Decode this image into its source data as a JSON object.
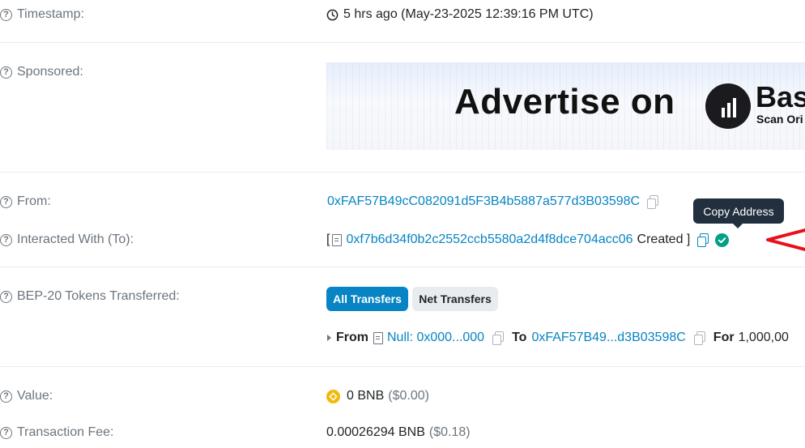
{
  "timestamp": {
    "label": "Timestamp:",
    "value": "5 hrs ago (May-23-2025 12:39:16 PM UTC)"
  },
  "sponsored": {
    "label": "Sponsored:",
    "ad_text": "Advertise on",
    "brand_text": "Bas",
    "brand_sub": "Scan Ori"
  },
  "from": {
    "label": "From:",
    "address": "0xFAF57B49cC082091d5F3B4b5887a577d3B03598C"
  },
  "interacted": {
    "label": "Interacted With (To):",
    "open_bracket": "[",
    "address": "0xf7b6d34f0b2c2552ccb5580a2d4f8dce704acc06",
    "created": "Created ]",
    "tooltip": "Copy Address"
  },
  "tokens": {
    "label": "BEP-20 Tokens Transferred:",
    "tab_all": "All Transfers",
    "tab_net": "Net Transfers",
    "from_kw": "From",
    "from_addr": "Null: 0x000...000",
    "to_kw": "To",
    "to_addr": "0xFAF57B49...d3B03598C",
    "for_kw": "For",
    "amount": "1,000,00"
  },
  "value": {
    "label": "Value:",
    "amount": "0 BNB",
    "usd": "($0.00)"
  },
  "fee": {
    "label": "Transaction Fee:",
    "amount": "0.00026294 BNB",
    "usd": "($0.18)"
  },
  "colors": {
    "link": "#0784c3",
    "label": "#6c757d",
    "success": "#00a186",
    "tooltip_bg": "#212f3f",
    "arrow": "#e8101a",
    "bnb": "#f0b90b"
  }
}
